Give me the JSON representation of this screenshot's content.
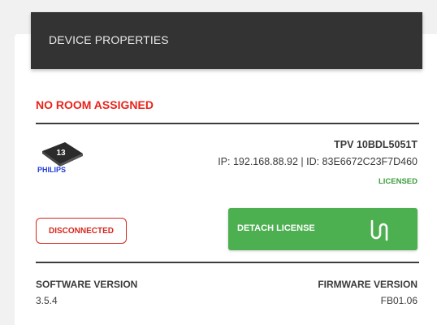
{
  "header": {
    "title": "DEVICE PROPERTIES"
  },
  "room": {
    "status": "NO ROOM ASSIGNED",
    "status_color": "#e8231a"
  },
  "device": {
    "logo_number": "13",
    "logo_brand": "PHILIPS",
    "model": "TPV 10BDL5051T",
    "ip_id_line": "IP: 192.168.88.92 | ID: 83E6672C23F7D460",
    "license_status": "LICENSED",
    "license_color": "#3c9b3c"
  },
  "connection": {
    "status": "DISCONNECTED",
    "status_color": "#d7261d"
  },
  "actions": {
    "detach_label": "DETACH LICENSE",
    "detach_icon": "detach-license-icon",
    "detach_color": "#4caf50"
  },
  "versions": {
    "software_label": "SOFTWARE VERSION",
    "software_value": "3.5.4",
    "firmware_label": "FIRMWARE VERSION",
    "firmware_value": "FB01.06"
  }
}
